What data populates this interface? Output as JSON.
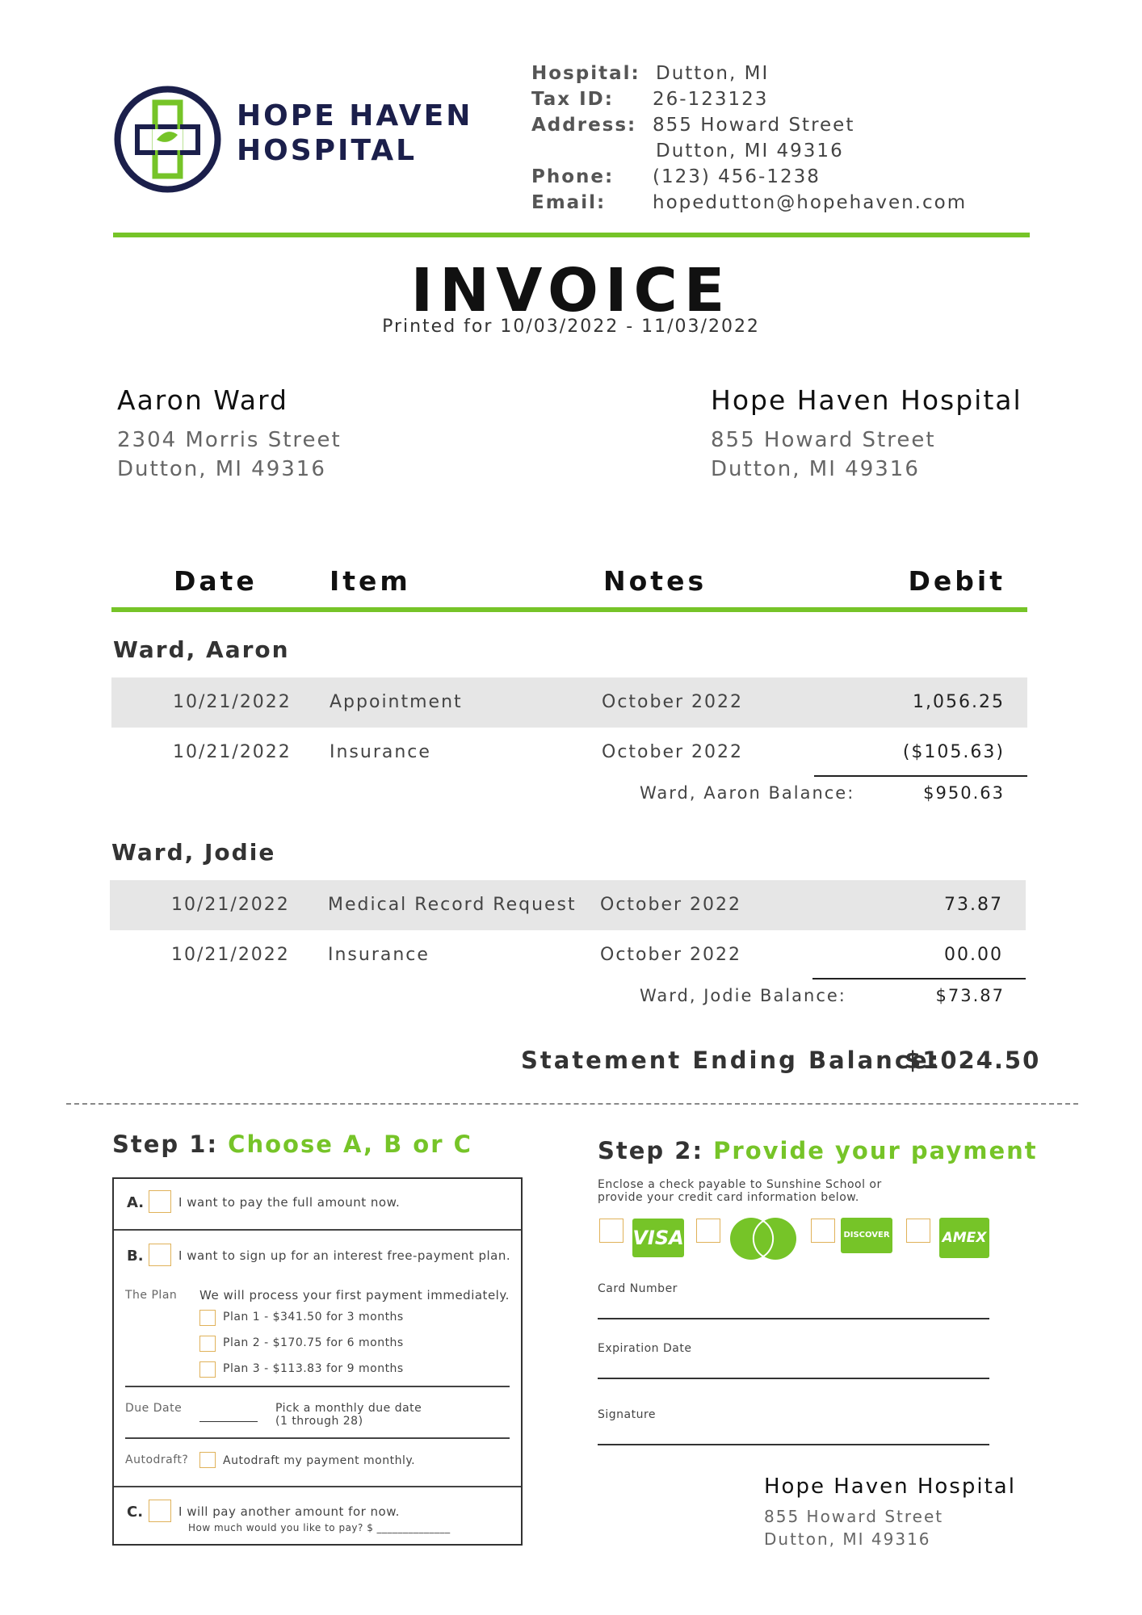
{
  "brand": {
    "name_line1": "HOPE HAVEN",
    "name_line2": "HOSPITAL",
    "accent": "#76c428",
    "navy": "#1b1f4b"
  },
  "header_info": {
    "hospital_label": "Hospital:",
    "hospital_value": "Dutton, MI",
    "tax_label": "Tax ID:",
    "tax_value": "26-123123",
    "address_label": "Address:",
    "address_line1": "855 Howard Street",
    "address_line2": "Dutton, MI 49316",
    "phone_label": "Phone:",
    "phone_value": "(123) 456-1238",
    "email_label": "Email:",
    "email_value": "hopedutton@hopehaven.com"
  },
  "title": "INVOICE",
  "printed_for": "Printed for 10/03/2022 - 11/03/2022",
  "bill_to": {
    "name": "Aaron Ward",
    "line1": "2304 Morris Street",
    "line2": "Dutton, MI 49316"
  },
  "from": {
    "name": "Hope Haven Hospital",
    "line1": "855 Howard Street",
    "line2": "Dutton, MI 49316"
  },
  "table": {
    "headers": [
      "Date",
      "Item",
      "Notes",
      "Debit"
    ],
    "groups": [
      {
        "name": "Ward, Aaron",
        "rows": [
          {
            "date": "10/21/2022",
            "item": "Appointment",
            "notes": "October 2022",
            "debit": "1,056.25"
          },
          {
            "date": "10/21/2022",
            "item": "Insurance",
            "notes": "October 2022",
            "debit": "($105.63)"
          }
        ],
        "balance_label": "Ward, Aaron Balance:",
        "balance_value": "$950.63"
      },
      {
        "name": "Ward, Jodie",
        "rows": [
          {
            "date": "10/21/2022",
            "item": "Medical Record Request",
            "notes": "October 2022",
            "debit": "73.87"
          },
          {
            "date": "10/21/2022",
            "item": "Insurance",
            "notes": "October 2022",
            "debit": "00.00"
          }
        ],
        "balance_label": "Ward, Jodie Balance:",
        "balance_value": "$73.87"
      }
    ]
  },
  "statement": {
    "label": "Statement Ending Balance:",
    "value": "$1024.50"
  },
  "step1": {
    "prefix": "Step 1:",
    "title": "Choose A, B or C",
    "option_a": {
      "letter": "A.",
      "text": "I want to pay the full amount now."
    },
    "option_b": {
      "letter": "B.",
      "text": "I want to sign up for an interest free-payment plan."
    },
    "plan_label": "The Plan",
    "plan_intro": "We will process your first payment immediately.",
    "plans": [
      "Plan 1 - $341.50 for 3 months",
      "Plan 2 - $170.75 for 6 months",
      "Plan 3 - $113.83 for 9 months"
    ],
    "due_label": "Due Date",
    "due_help_line1": "Pick a monthly due date",
    "due_help_line2": "(1 through 28)",
    "autodraft_label": "Autodraft?",
    "autodraft_text": "Autodraft my payment monthly.",
    "option_c": {
      "letter": "C.",
      "text": "I will pay another amount for now.",
      "sub": "How much would you like to pay? $ ______________"
    }
  },
  "step2": {
    "prefix": "Step 2:",
    "title": "Provide your payment",
    "instructions_line1": "Enclose a check payable to Sunshine School or",
    "instructions_line2": "provide your credit card information below.",
    "cards": [
      {
        "name": "VISA",
        "icon": "visa-icon"
      },
      {
        "name": "",
        "icon": "mastercard-icon"
      },
      {
        "name": "DISCOVER",
        "icon": "discover-icon"
      },
      {
        "name": "AMEX",
        "icon": "amex-icon"
      }
    ],
    "card_number_label": "Card Number",
    "expiration_label": "Expiration Date",
    "signature_label": "Signature"
  },
  "remit": {
    "name": "Hope Haven Hospital",
    "line1": "855 Howard Street",
    "line2": "Dutton, MI 49316"
  }
}
